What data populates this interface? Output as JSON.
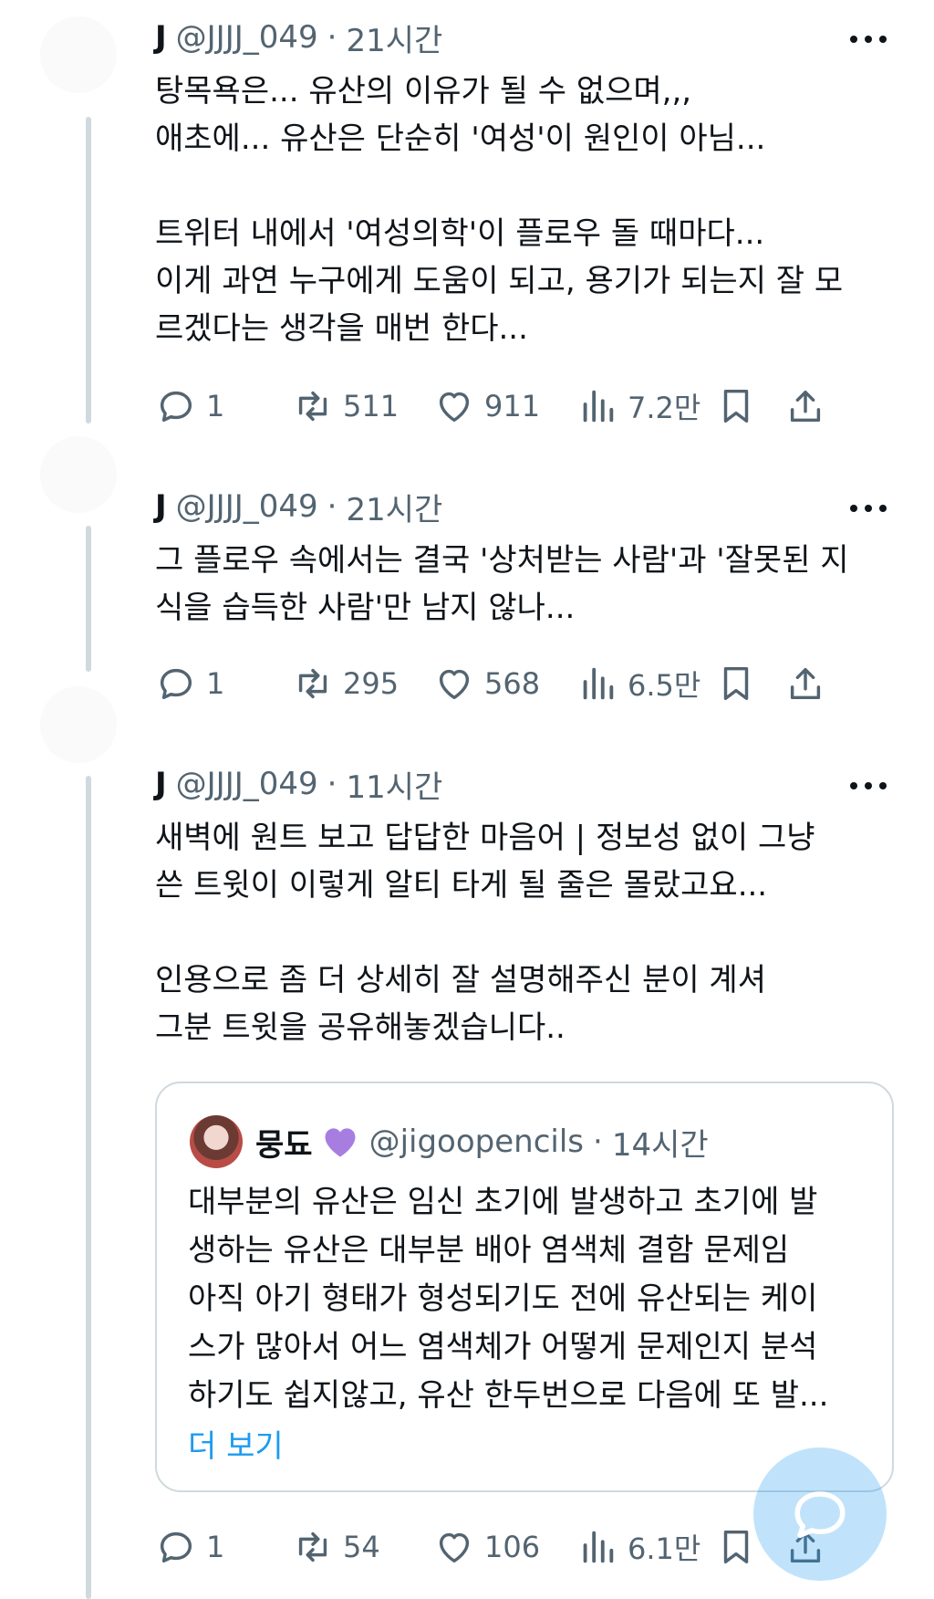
{
  "tweets": [
    {
      "name": "J",
      "handle": "@JJJJ_049",
      "time": "21시간",
      "text": "탕목욕은... 유산의 이유가 될 수 없으며,,,\n애초에... 유산은 단순히 '여성'이 원인이 아님...\n\n트위터 내에서 '여성의학'이 플로우 돌 때마다...\n이게 과연 누구에게 도움이 되고, 용기가 되는지 잘 모\n르겠다는 생각을 매번 한다...",
      "replies": "1",
      "retweets": "511",
      "likes": "911",
      "views": "7.2만"
    },
    {
      "name": "J",
      "handle": "@JJJJ_049",
      "time": "21시간",
      "text": "그 플로우 속에서는 결국 '상처받는 사람'과 '잘못된 지\n식을 습득한 사람'만 남지 않나...",
      "replies": "1",
      "retweets": "295",
      "likes": "568",
      "views": "6.5만"
    },
    {
      "name": "J",
      "handle": "@JJJJ_049",
      "time": "11시간",
      "text": "새벽에 원트 보고 답답한 마음어 | 정보성 없이 그냥\n쓴 트윗이 이렇게 알티 타게 될 줄은 몰랐고요...\n\n인용으로 좀 더 상세히 잘 설명해주신 분이 계셔\n그분 트윗을 공유해놓겠습니다..",
      "replies": "1",
      "retweets": "54",
      "likes": "106",
      "views": "6.1만",
      "quote": {
        "name": "뭉됴",
        "handle": "@jigoopencils",
        "time": "14시간",
        "text": "대부분의 유산은 임신 초기에 발생하고 초기에 발\n생하는 유산은 대부분 배아 염색체 결함 문제임\n아직 아기 형태가 형성되기도 전에 유산되는 케이\n스가 많아서 어느 염색체가 어떻게 문제인지 분석\n하기도 쉽지않고, 유산 한두번으로 다음에 또 발...",
        "more_label": "더 보기"
      }
    }
  ],
  "separator": "·",
  "icons": {
    "reply": "reply-icon",
    "retweet": "retweet-icon",
    "like": "heart-icon",
    "views": "views-icon",
    "bookmark": "bookmark-icon",
    "share": "share-icon",
    "more": "more-icon",
    "compose": "compose-icon",
    "heart_emoji": "purple-heart-icon"
  },
  "colors": {
    "text": "#0f1419",
    "muted": "#536471",
    "link": "#1d9bf0",
    "border": "#cfd9de"
  }
}
